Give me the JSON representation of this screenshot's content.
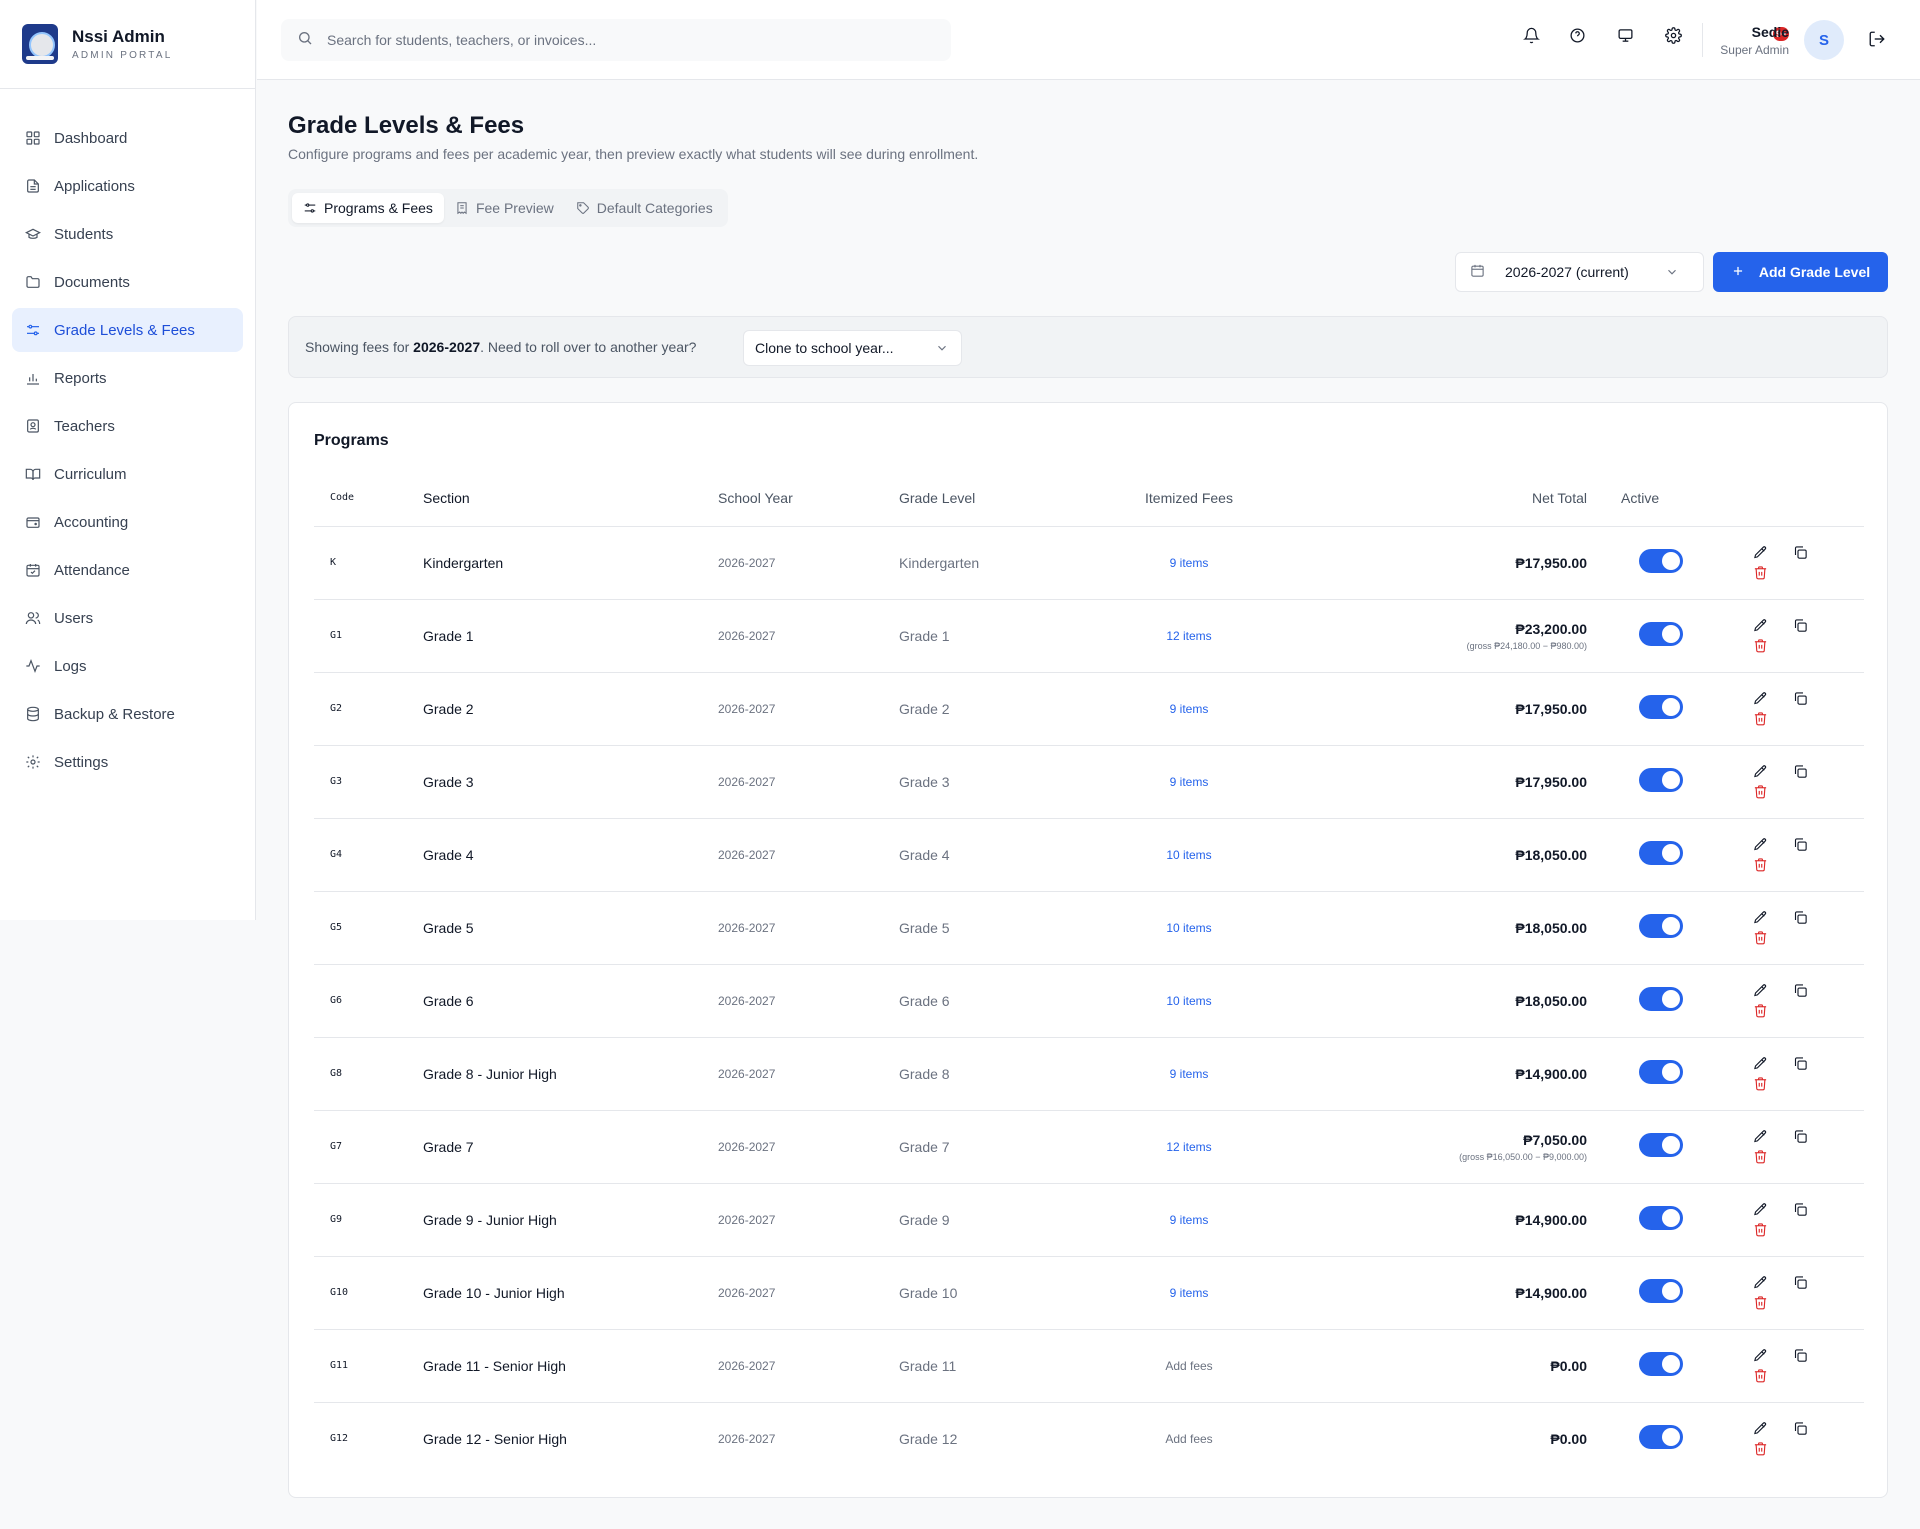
{
  "brand": {
    "title": "Nssi Admin",
    "subtitle": "ADMIN PORTAL"
  },
  "sidebar": {
    "items": [
      {
        "label": "Dashboard",
        "icon": "dashboard-icon",
        "active": false
      },
      {
        "label": "Applications",
        "icon": "file-text-icon",
        "active": false
      },
      {
        "label": "Students",
        "icon": "graduation-cap-icon",
        "active": false
      },
      {
        "label": "Documents",
        "icon": "folder-icon",
        "active": false
      },
      {
        "label": "Grade Levels & Fees",
        "icon": "sliders-icon",
        "active": true
      },
      {
        "label": "Reports",
        "icon": "bar-chart-icon",
        "active": false
      },
      {
        "label": "Teachers",
        "icon": "id-badge-icon",
        "active": false
      },
      {
        "label": "Curriculum",
        "icon": "book-open-icon",
        "active": false
      },
      {
        "label": "Accounting",
        "icon": "wallet-icon",
        "active": false
      },
      {
        "label": "Attendance",
        "icon": "calendar-check-icon",
        "active": false
      },
      {
        "label": "Users",
        "icon": "users-icon",
        "active": false
      },
      {
        "label": "Logs",
        "icon": "activity-icon",
        "active": false
      },
      {
        "label": "Backup & Restore",
        "icon": "database-icon",
        "active": false
      },
      {
        "label": "Settings",
        "icon": "gear-icon",
        "active": false
      }
    ]
  },
  "topbar": {
    "search_placeholder": "Search for students, teachers, or invoices...",
    "notification_badge": "9+",
    "user_name": "Sedie",
    "user_role": "Super Admin",
    "avatar_initial": "S"
  },
  "page": {
    "title": "Grade Levels & Fees",
    "subtitle": "Configure programs and fees per academic year, then preview exactly what students will see during enrollment.",
    "tabs": [
      {
        "label": "Programs & Fees",
        "icon": "sliders-icon",
        "active": true
      },
      {
        "label": "Fee Preview",
        "icon": "receipt-icon",
        "active": false
      },
      {
        "label": "Default Categories",
        "icon": "tag-icon",
        "active": false
      }
    ],
    "year_select": "2026-2027 (current)",
    "add_button": "Add Grade Level",
    "notice_prefix": "Showing fees for ",
    "notice_year": "2026-2027",
    "notice_suffix": ". Need to roll over to another year?",
    "clone_select": "Clone to school year..."
  },
  "programs": {
    "title": "Programs",
    "columns": [
      "Code",
      "Section",
      "School Year",
      "Grade Level",
      "Itemized Fees",
      "Net Total",
      "Active"
    ],
    "rows": [
      {
        "code": "K",
        "section": "Kindergarten",
        "year": "2026-2027",
        "grade": "Kindergarten",
        "fees": "9 items",
        "net": "₱17,950.00",
        "gross": "",
        "active": true
      },
      {
        "code": "G1",
        "section": "Grade 1",
        "year": "2026-2027",
        "grade": "Grade 1",
        "fees": "12 items",
        "net": "₱23,200.00",
        "gross": "(gross ₱24,180.00 − ₱980.00)",
        "active": true
      },
      {
        "code": "G2",
        "section": "Grade 2",
        "year": "2026-2027",
        "grade": "Grade 2",
        "fees": "9 items",
        "net": "₱17,950.00",
        "gross": "",
        "active": true
      },
      {
        "code": "G3",
        "section": "Grade 3",
        "year": "2026-2027",
        "grade": "Grade 3",
        "fees": "9 items",
        "net": "₱17,950.00",
        "gross": "",
        "active": true
      },
      {
        "code": "G4",
        "section": "Grade 4",
        "year": "2026-2027",
        "grade": "Grade 4",
        "fees": "10 items",
        "net": "₱18,050.00",
        "gross": "",
        "active": true
      },
      {
        "code": "G5",
        "section": "Grade 5",
        "year": "2026-2027",
        "grade": "Grade 5",
        "fees": "10 items",
        "net": "₱18,050.00",
        "gross": "",
        "active": true
      },
      {
        "code": "G6",
        "section": "Grade 6",
        "year": "2026-2027",
        "grade": "Grade 6",
        "fees": "10 items",
        "net": "₱18,050.00",
        "gross": "",
        "active": true
      },
      {
        "code": "G8",
        "section": "Grade 8 - Junior High",
        "year": "2026-2027",
        "grade": "Grade 8",
        "fees": "9 items",
        "net": "₱14,900.00",
        "gross": "",
        "active": true
      },
      {
        "code": "G7",
        "section": "Grade 7",
        "year": "2026-2027",
        "grade": "Grade 7",
        "fees": "12 items",
        "net": "₱7,050.00",
        "gross": "(gross ₱16,050.00 − ₱9,000.00)",
        "active": true
      },
      {
        "code": "G9",
        "section": "Grade 9 - Junior High",
        "year": "2026-2027",
        "grade": "Grade 9",
        "fees": "9 items",
        "net": "₱14,900.00",
        "gross": "",
        "active": true
      },
      {
        "code": "G10",
        "section": "Grade 10 - Junior High",
        "year": "2026-2027",
        "grade": "Grade 10",
        "fees": "9 items",
        "net": "₱14,900.00",
        "gross": "",
        "active": true
      },
      {
        "code": "G11",
        "section": "Grade 11 - Senior High",
        "year": "2026-2027",
        "grade": "Grade 11",
        "fees": "Add fees",
        "net": "₱0.00",
        "gross": "",
        "active": true
      },
      {
        "code": "G12",
        "section": "Grade 12 - Senior High",
        "year": "2026-2027",
        "grade": "Grade 12",
        "fees": "Add fees",
        "net": "₱0.00",
        "gross": "",
        "active": true
      }
    ]
  }
}
